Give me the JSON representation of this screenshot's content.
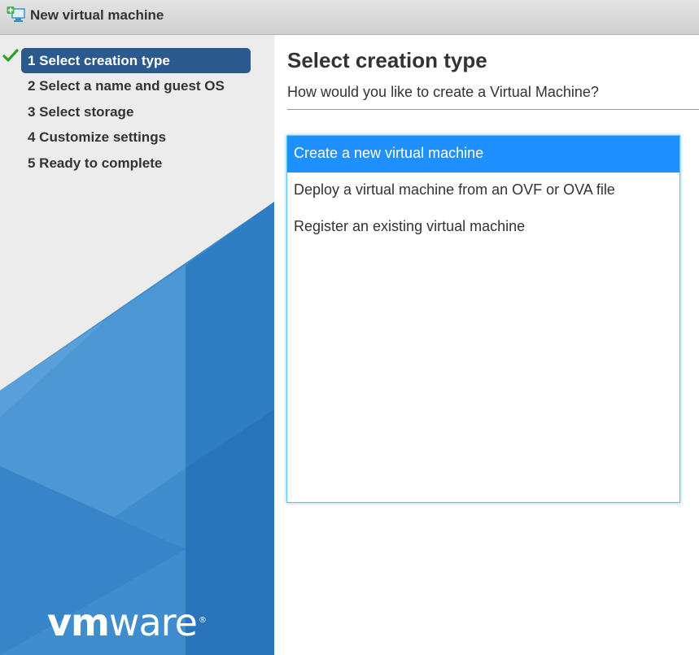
{
  "window": {
    "title": "New virtual machine",
    "icon": "new-vm-icon"
  },
  "sidebar": {
    "steps": [
      {
        "label": "1 Select creation type",
        "active": true,
        "completed": true
      },
      {
        "label": "2 Select a name and guest OS",
        "active": false,
        "completed": false
      },
      {
        "label": "3 Select storage",
        "active": false,
        "completed": false
      },
      {
        "label": "4 Customize settings",
        "active": false,
        "completed": false
      },
      {
        "label": "5 Ready to complete",
        "active": false,
        "completed": false
      }
    ],
    "logo": {
      "vm": "vm",
      "ware": "ware",
      "reg": "®"
    }
  },
  "main": {
    "heading": "Select creation type",
    "subheading": "How would you like to create a Virtual Machine?",
    "options": [
      {
        "label": "Create a new virtual machine",
        "selected": true
      },
      {
        "label": "Deploy a virtual machine from an OVF or OVA file",
        "selected": false
      },
      {
        "label": "Register an existing virtual machine",
        "selected": false
      }
    ]
  },
  "colors": {
    "active_step": "#2b5a8f",
    "selected_option": "#1e90ff",
    "listbox_border": "#5ec8f2",
    "check": "#2e9e2e"
  }
}
